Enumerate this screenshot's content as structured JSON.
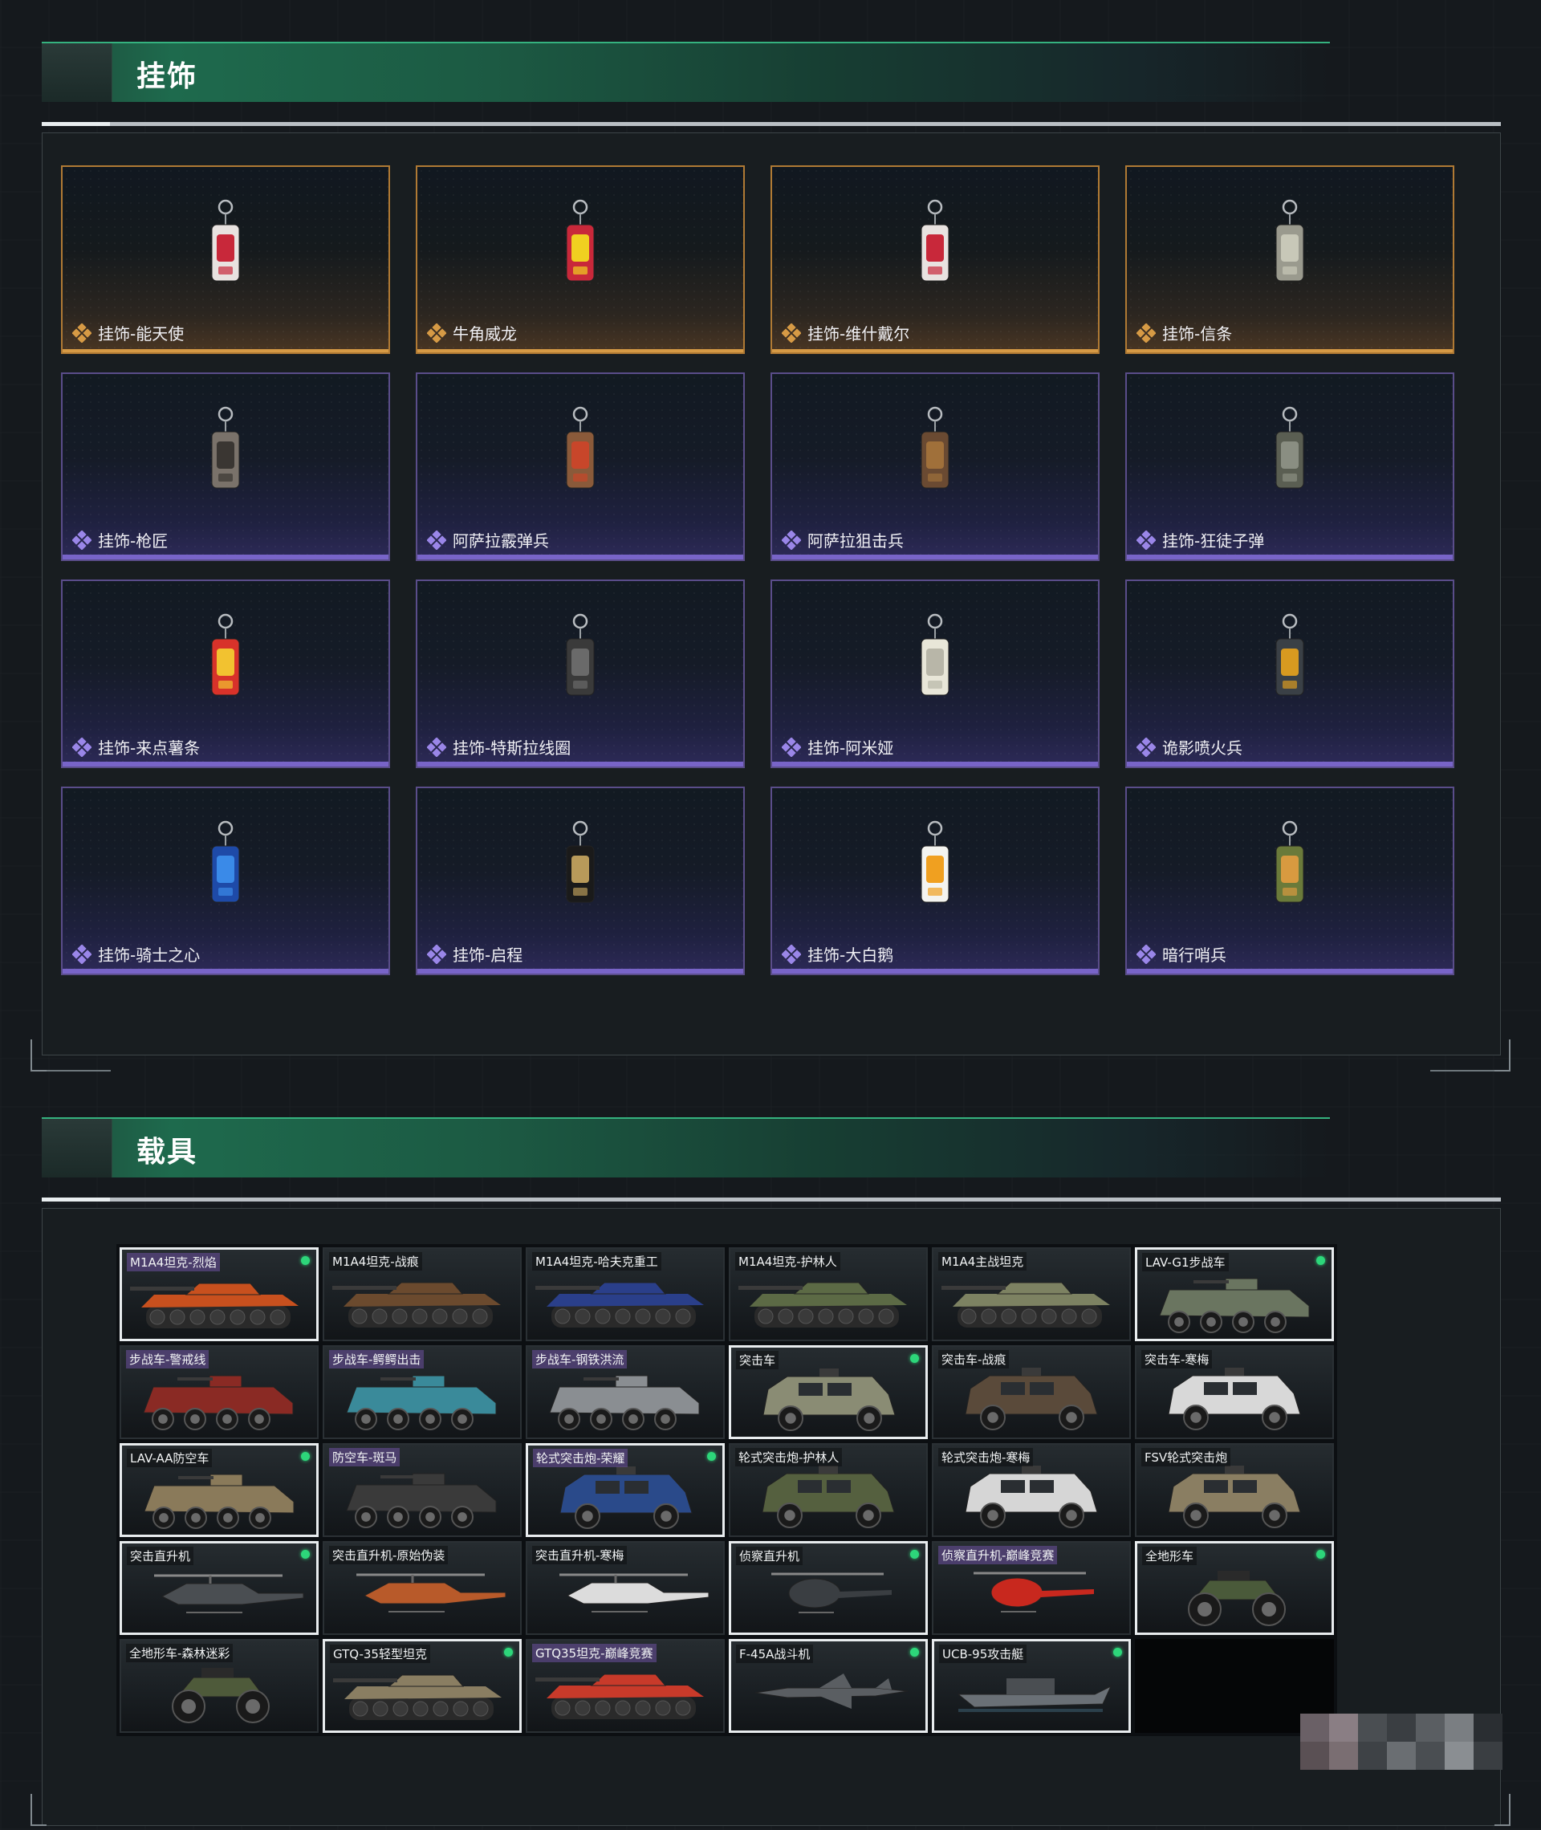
{
  "sections": {
    "charms": {
      "title": "挂饰",
      "items": [
        {
          "label": "挂饰-能天使",
          "rarity": "gold",
          "icon": "charm-angel-icon"
        },
        {
          "label": "牛角威龙",
          "rarity": "gold",
          "icon": "charm-horn-dragon-icon"
        },
        {
          "label": "挂饰-维什戴尔",
          "rarity": "gold",
          "icon": "charm-wisadel-icon"
        },
        {
          "label": "挂饰-信条",
          "rarity": "gold",
          "icon": "charm-creed-icon"
        },
        {
          "label": "挂饰-枪匠",
          "rarity": "purple",
          "icon": "charm-gunsmith-icon"
        },
        {
          "label": "阿萨拉霰弹兵",
          "rarity": "purple",
          "icon": "charm-shotgunner-icon"
        },
        {
          "label": "阿萨拉狙击兵",
          "rarity": "purple",
          "icon": "charm-sniper-icon"
        },
        {
          "label": "挂饰-狂徒子弹",
          "rarity": "purple",
          "icon": "charm-bullet-icon"
        },
        {
          "label": "挂饰-来点薯条",
          "rarity": "purple",
          "icon": "charm-fries-icon"
        },
        {
          "label": "挂饰-特斯拉线圈",
          "rarity": "purple",
          "icon": "charm-tesla-icon"
        },
        {
          "label": "挂饰-阿米娅",
          "rarity": "purple",
          "icon": "charm-amiya-icon"
        },
        {
          "label": "诡影喷火兵",
          "rarity": "purple",
          "icon": "charm-flamer-icon"
        },
        {
          "label": "挂饰-骑士之心",
          "rarity": "purple",
          "icon": "charm-knight-heart-icon"
        },
        {
          "label": "挂饰-启程",
          "rarity": "purple",
          "icon": "charm-departure-icon"
        },
        {
          "label": "挂饰-大白鹅",
          "rarity": "purple",
          "icon": "charm-goose-icon"
        },
        {
          "label": "暗行哨兵",
          "rarity": "purple",
          "icon": "charm-sentinel-icon"
        }
      ]
    },
    "vehicles": {
      "title": "载具",
      "items": [
        {
          "label": "M1A4坦克-烈焰",
          "owned": true,
          "kind": "tank",
          "color": "#c8501e",
          "purple": true
        },
        {
          "label": "M1A4坦克-战痕",
          "owned": false,
          "kind": "tank",
          "color": "#6b4a2e",
          "purple": false
        },
        {
          "label": "M1A4坦克-哈夫克重工",
          "owned": false,
          "kind": "tank",
          "color": "#2a3f8a",
          "purple": false
        },
        {
          "label": "M1A4坦克-护林人",
          "owned": false,
          "kind": "tank",
          "color": "#5c6a45",
          "purple": false
        },
        {
          "label": "M1A4主战坦克",
          "owned": false,
          "kind": "tank",
          "color": "#7d8262",
          "purple": false
        },
        {
          "label": "LAV-G1步战车",
          "owned": true,
          "kind": "apc",
          "color": "#6a7560",
          "purple": false
        },
        {
          "label": "步战车-警戒线",
          "owned": false,
          "kind": "apc",
          "color": "#8a2a24",
          "purple": true
        },
        {
          "label": "步战车-鳄鳄出击",
          "owned": false,
          "kind": "apc",
          "color": "#3a8a9a",
          "purple": true
        },
        {
          "label": "步战车-钢铁洪流",
          "owned": false,
          "kind": "apc",
          "color": "#8a8e92",
          "purple": true
        },
        {
          "label": "突击车",
          "owned": true,
          "kind": "jeep",
          "color": "#8a8c74",
          "purple": false
        },
        {
          "label": "突击车-战痕",
          "owned": false,
          "kind": "jeep",
          "color": "#5a4a3a",
          "purple": false
        },
        {
          "label": "突击车-寒梅",
          "owned": false,
          "kind": "jeep",
          "color": "#d8d8d8",
          "purple": false
        },
        {
          "label": "LAV-AA防空车",
          "owned": true,
          "kind": "apc",
          "color": "#8a7a5a",
          "purple": false
        },
        {
          "label": "防空车-斑马",
          "owned": false,
          "kind": "apc",
          "color": "#3a3a3a",
          "purple": true
        },
        {
          "label": "轮式突击炮-荣耀",
          "owned": true,
          "kind": "jeep",
          "color": "#2a4a8a",
          "purple": true
        },
        {
          "label": "轮式突击炮-护林人",
          "owned": false,
          "kind": "jeep",
          "color": "#55603f",
          "purple": false
        },
        {
          "label": "轮式突击炮-寒梅",
          "owned": false,
          "kind": "jeep",
          "color": "#d6d6d6",
          "purple": false
        },
        {
          "label": "FSV轮式突击炮",
          "owned": false,
          "kind": "jeep",
          "color": "#8a7e62",
          "purple": false
        },
        {
          "label": "突击直升机",
          "owned": true,
          "kind": "heli",
          "color": "#4a4e52",
          "purple": false
        },
        {
          "label": "突击直升机-原始伪装",
          "owned": false,
          "kind": "heli",
          "color": "#b85a2a",
          "purple": false
        },
        {
          "label": "突击直升机-寒梅",
          "owned": false,
          "kind": "heli",
          "color": "#dcdcdc",
          "purple": false
        },
        {
          "label": "侦察直升机",
          "owned": true,
          "kind": "smallheli",
          "color": "#3a3e42",
          "purple": false
        },
        {
          "label": "侦察直升机-巅峰竞赛",
          "owned": false,
          "kind": "smallheli",
          "color": "#c8281e",
          "purple": true
        },
        {
          "label": "全地形车",
          "owned": true,
          "kind": "atv",
          "color": "#4a5a3a",
          "purple": false
        },
        {
          "label": "全地形车-森林迷彩",
          "owned": false,
          "kind": "atv",
          "color": "#4e5a3a",
          "purple": false
        },
        {
          "label": "GTQ-35轻型坦克",
          "owned": true,
          "kind": "tank",
          "color": "#8a7e62",
          "purple": false
        },
        {
          "label": "GTQ35坦克-巅峰竞赛",
          "owned": false,
          "kind": "tank",
          "color": "#c83a2a",
          "purple": true
        },
        {
          "label": "F-45A战斗机",
          "owned": true,
          "kind": "jet",
          "color": "#5a5e62",
          "purple": false
        },
        {
          "label": "UCB-95攻击艇",
          "owned": true,
          "kind": "boat",
          "color": "#6a7076",
          "purple": false
        }
      ]
    }
  },
  "colors": {
    "accent_green": "#35b27f",
    "gold_rarity": "#d69a45",
    "purple_rarity": "#7864c8",
    "owned_dot": "#2dd67a"
  }
}
